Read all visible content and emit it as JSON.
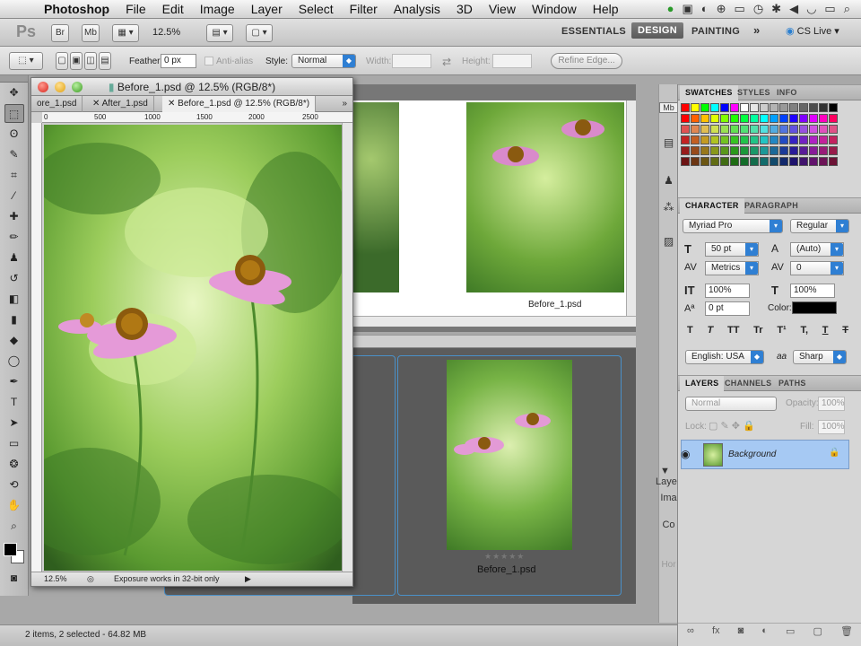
{
  "menubar": {
    "items": [
      "Photoshop",
      "File",
      "Edit",
      "Image",
      "Layer",
      "Select",
      "Filter",
      "Analysis",
      "3D",
      "View",
      "Window",
      "Help"
    ]
  },
  "appbar": {
    "logo": "Ps",
    "btn_br": "Br",
    "btn_mb": "Mb",
    "zoom": "12.5%",
    "workspaces": [
      "ESSENTIALS",
      "DESIGN",
      "PAINTING"
    ],
    "more": "»",
    "cslive": "CS Live"
  },
  "options": {
    "feather_label": "Feather:",
    "feather_value": "0 px",
    "antialias": "Anti-alias",
    "style_label": "Style:",
    "style_value": "Normal",
    "width_label": "Width:",
    "height_label": "Height:",
    "refine": "Refine Edge..."
  },
  "doc": {
    "title": "Before_1.psd @ 12.5% (RGB/8*)",
    "tabs": [
      "ore_1.psd",
      "After_1.psd",
      "Before_1.psd @ 12.5% (RGB/8*)"
    ],
    "tab_more": "»",
    "ruler_marks": [
      "0",
      "500",
      "1000",
      "1500",
      "2000",
      "2500"
    ],
    "status_zoom": "12.5%",
    "status_text": "Exposure works in 32-bit only"
  },
  "bg_doc": {
    "caption": "Before_1.psd"
  },
  "mini": {
    "caption": "Before_1.psd",
    "stars": "★★★★★",
    "side_labels": [
      "Laye",
      "Ima",
      "Co",
      "Hor"
    ]
  },
  "panels": {
    "swatch_tabs": [
      "SWATCHES",
      "STYLES",
      "INFO"
    ],
    "char_tabs": [
      "CHARACTER",
      "PARAGRAPH"
    ],
    "font_family": "Myriad Pro",
    "font_style": "Regular",
    "font_size": "50 pt",
    "leading": "(Auto)",
    "kerning": "Metrics",
    "tracking": "0",
    "vscale": "100%",
    "hscale": "100%",
    "baseline": "0 pt",
    "color_label": "Color:",
    "type_buttons": [
      "T",
      "T",
      "TT",
      "Tr",
      "T¹",
      "T,",
      "T",
      "T"
    ],
    "language": "English: USA",
    "aa_label": "aa",
    "aa_value": "Sharp",
    "layers_tabs": [
      "LAYERS",
      "CHANNELS",
      "PATHS"
    ],
    "blend_mode": "Normal",
    "opacity_label": "Opacity:",
    "opacity_value": "100%",
    "lock_label": "Lock:",
    "fill_label": "Fill:",
    "fill_value": "100%",
    "layer_name": "Background",
    "text_color": "#000000",
    "selected_layer_color": "#a6c9f3"
  },
  "status": {
    "text": "2 items, 2 selected - 64.82 MB"
  }
}
